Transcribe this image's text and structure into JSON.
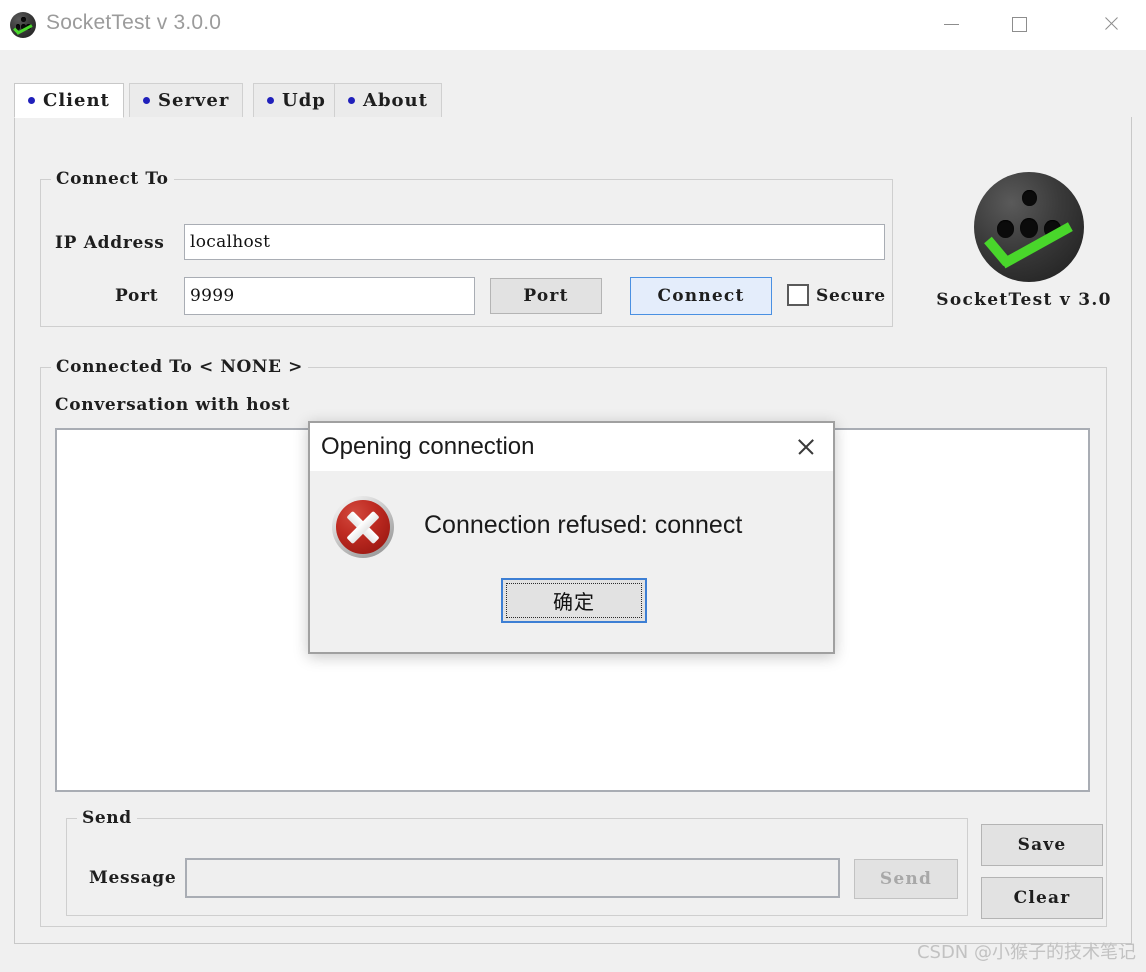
{
  "window": {
    "title": "SocketTest v 3.0.0",
    "app_icon": "socket-ball-icon",
    "controls": {
      "minimize": "minimize-icon",
      "maximize": "maximize-icon",
      "close": "close-icon"
    }
  },
  "tabs": [
    {
      "label": "Client",
      "active": true
    },
    {
      "label": "Server",
      "active": false
    },
    {
      "label": "Udp",
      "active": false
    },
    {
      "label": "About",
      "active": false
    }
  ],
  "connect_group": {
    "title": "Connect To",
    "ip_label": "IP Address",
    "ip_value": "localhost",
    "ip_placeholder": "",
    "port_label": "Port",
    "port_value": "9999",
    "port_placeholder": "",
    "port_button": "Port",
    "connect_button": "Connect",
    "secure_label": "Secure",
    "secure_checked": false
  },
  "logo": {
    "caption": "SocketTest v 3.0",
    "icon": "socket-ball-icon"
  },
  "connected_group": {
    "title": "Connected To < NONE >",
    "conversation_label": "Conversation with host",
    "conversation_text": ""
  },
  "send_group": {
    "title": "Send",
    "message_label": "Message",
    "message_value": "",
    "message_placeholder": "",
    "send_button": "Send",
    "send_disabled": true
  },
  "side_buttons": {
    "save": "Save",
    "clear": "Clear"
  },
  "dialog": {
    "title": "Opening connection",
    "message": "Connection refused: connect",
    "ok_button": "确定",
    "close_icon": "close-icon",
    "error_icon": "error-circle-icon"
  },
  "watermark": "CSDN @小猴子的技术笔记",
  "colors": {
    "window_bg": "#f0f0f0",
    "titlebar_bg": "#ffffff",
    "accent_focus": "#4a90e2",
    "dialog_ok_border": "#3d7fd4",
    "error_red": "#bf2b22",
    "logo_green": "#49d62b",
    "tab_dot_blue": "#2020bb",
    "watermark_gray": "#c2c2c2"
  }
}
